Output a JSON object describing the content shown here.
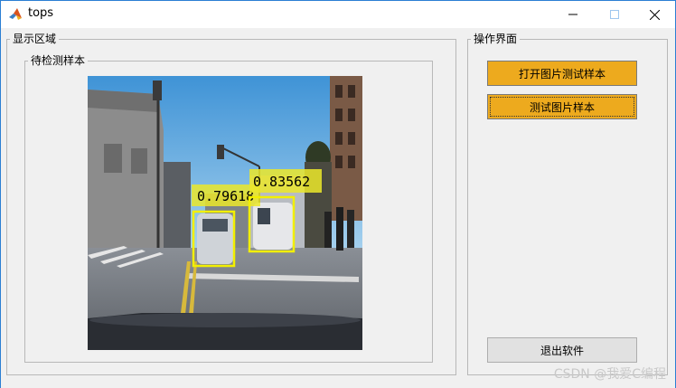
{
  "window": {
    "title": "tops"
  },
  "display_panel": {
    "legend": "显示区域",
    "sample_group_legend": "待检测样本"
  },
  "detections": [
    {
      "score_label": "0.79618",
      "color": "#f2ef00"
    },
    {
      "score_label": "0.83562",
      "color": "#f2ef00"
    }
  ],
  "operation_panel": {
    "legend": "操作界面",
    "open_button_label": "打开图片测试样本",
    "test_button_label": "测试图片样本",
    "exit_button_label": "退出软件"
  },
  "watermark": "CSDN @我爱C编程",
  "colors": {
    "accent_button": "#edaa1e",
    "window_border": "#2b7fd3",
    "box_color": "#f2ef00"
  }
}
